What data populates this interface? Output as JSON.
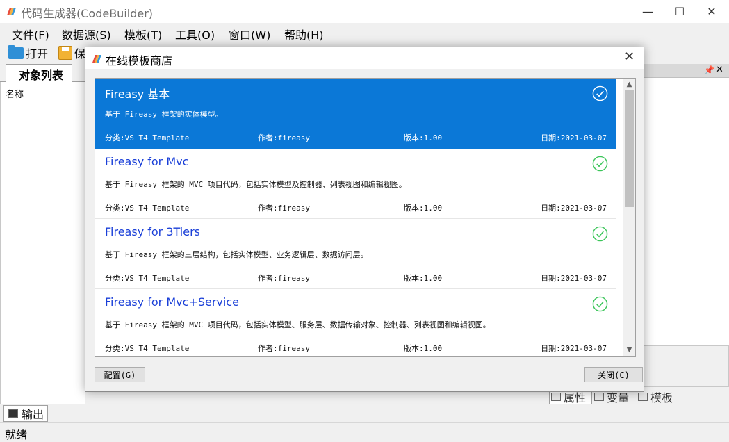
{
  "window": {
    "title": "代码生成器(CodeBuilder)",
    "controls": {
      "minimize": "—",
      "maximize": "☐",
      "close": "✕"
    }
  },
  "menu": [
    "文件(F)",
    "数据源(S)",
    "模板(T)",
    "工具(O)",
    "窗口(W)",
    "帮助(H)"
  ],
  "toolbar": {
    "open_label": "打开",
    "save_label": "保"
  },
  "left_panel": {
    "tab_label": "对象列表",
    "column_header": "名称"
  },
  "right_panel": {
    "pin_icon": "pin-icon",
    "tabs": [
      "属性",
      "变量",
      "模板"
    ]
  },
  "output_tab": {
    "label": "输出"
  },
  "status": {
    "text": "就绪"
  },
  "dialog": {
    "title": "在线模板商店",
    "close_glyph": "✕",
    "config_button": "配置(G)",
    "close_button": "关闭(C)",
    "templates": [
      {
        "name": "Fireasy 基本",
        "description": "基于 Fireasy 框架的实体模型。",
        "category": "分类:VS T4 Template",
        "author": "作者:fireasy",
        "version": "版本:1.00",
        "date": "日期:2021-03-07",
        "selected": true
      },
      {
        "name": "Fireasy for Mvc",
        "description": "基于 Fireasy 框架的 MVC 项目代码，包括实体模型及控制器、列表视图和编辑视图。",
        "category": "分类:VS T4 Template",
        "author": "作者:fireasy",
        "version": "版本:1.00",
        "date": "日期:2021-03-07",
        "selected": false
      },
      {
        "name": "Fireasy for 3Tiers",
        "description": "基于 Fireasy 框架的三层结构，包括实体模型、业务逻辑层、数据访问层。",
        "category": "分类:VS T4 Template",
        "author": "作者:fireasy",
        "version": "版本:1.00",
        "date": "日期:2021-03-07",
        "selected": false
      },
      {
        "name": "Fireasy for Mvc+Service",
        "description": "基于 Fireasy 框架的 MVC 项目代码，包括实体模型、服务层、数据传输对象、控制器、列表视图和编辑视图。",
        "category": "分类:VS T4 Template",
        "author": "作者:fireasy",
        "version": "版本:1.00",
        "date": "日期:2021-03-07",
        "selected": false
      }
    ]
  },
  "colors": {
    "selection": "#0b78d7",
    "template_name": "#1a3fd8",
    "installed_check": "#3cc55a"
  }
}
